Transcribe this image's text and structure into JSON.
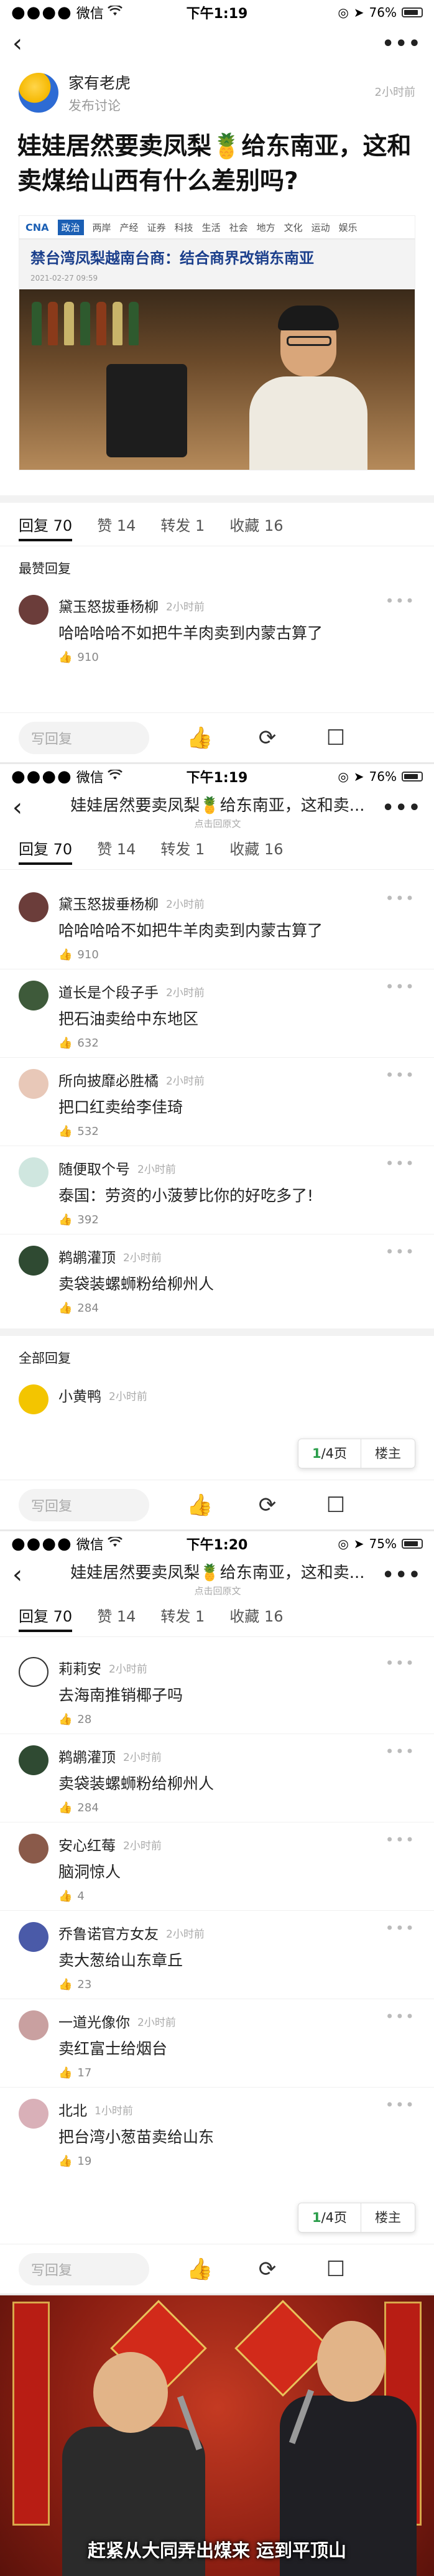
{
  "status": {
    "carrier": "微信",
    "screens": [
      {
        "time": "下午1:19",
        "battery": "76%"
      },
      {
        "time": "下午1:19",
        "battery": "76%"
      },
      {
        "time": "下午1:20",
        "battery": "75%"
      }
    ]
  },
  "post": {
    "author": "家有老虎",
    "author_sub": "发布讨论",
    "time": "2小时前",
    "title": "娃娃居然要卖凤梨🍍给东南亚，这和卖煤给山西有什么差别吗?",
    "image": {
      "tabs": [
        "政治",
        "两岸",
        "产经",
        "证券",
        "科技",
        "生活",
        "社会",
        "地方",
        "文化",
        "运动",
        "娱乐"
      ],
      "headline": "禁台湾凤梨越南台商：结合商界改销东南亚",
      "date": "2021-02-27 09:59"
    }
  },
  "tabs": {
    "reply": "回复",
    "reply_count": "70",
    "like": "赞",
    "like_count": "14",
    "repost": "转发",
    "repost_count": "1",
    "fav": "收藏",
    "fav_count": "16"
  },
  "nav": {
    "title": "娃娃居然要卖凤梨🍍给东南亚，这和卖...",
    "subtitle": "点击回原文"
  },
  "labels": {
    "best_replies": "最赞回复",
    "all_replies": "全部回复",
    "reply_placeholder": "写回复",
    "page": "1",
    "page_total": "/4页",
    "owner_only": "楼主"
  },
  "comments_best_first": [
    {
      "name": "黛玉怒拔垂杨柳",
      "time": "2小时前",
      "text": "哈哈哈哈不如把牛羊肉卖到内蒙古算了",
      "likes": "910"
    }
  ],
  "comments_best": [
    {
      "name": "黛玉怒拔垂杨柳",
      "time": "2小时前",
      "text": "哈哈哈哈不如把牛羊肉卖到内蒙古算了",
      "likes": "910"
    },
    {
      "name": "道长是个段子手",
      "time": "2小时前",
      "text": "把石油卖给中东地区",
      "likes": "632"
    },
    {
      "name": "所向披靡必胜橘",
      "time": "2小时前",
      "text": "把口红卖给李佳琦",
      "likes": "532"
    },
    {
      "name": "随便取个号",
      "time": "2小时前",
      "text": "泰国：劳资的小菠萝比你的好吃多了!",
      "likes": "392"
    },
    {
      "name": "鹈鹕灌顶",
      "time": "2小时前",
      "text": "卖袋装螺蛳粉给柳州人",
      "likes": "284"
    }
  ],
  "comment_partial": {
    "name": "小黄鸭",
    "time": "2小时前"
  },
  "comments_all": [
    {
      "name": "莉莉安",
      "time": "2小时前",
      "text": "去海南推销椰子吗",
      "likes": "28"
    },
    {
      "name": "鹈鹕灌顶",
      "time": "2小时前",
      "text": "卖袋装螺蛳粉给柳州人",
      "likes": "284"
    },
    {
      "name": "安心红莓",
      "time": "2小时前",
      "text": "脑洞惊人",
      "likes": "4"
    },
    {
      "name": "乔鲁诺官方女友",
      "time": "2小时前",
      "text": "卖大葱给山东章丘",
      "likes": "23"
    },
    {
      "name": "一道光像你",
      "time": "2小时前",
      "text": "卖红富士给烟台",
      "likes": "17"
    },
    {
      "name": "北北",
      "time": "1小时前",
      "text": "把台湾小葱苗卖给山东",
      "likes": "19"
    }
  ],
  "meme": {
    "subtitle": "赶紧从大同弄出煤来 运到平顶山"
  },
  "colors": {
    "accent_green": "#2a9d4a",
    "meme_red": "#8a1e12"
  }
}
